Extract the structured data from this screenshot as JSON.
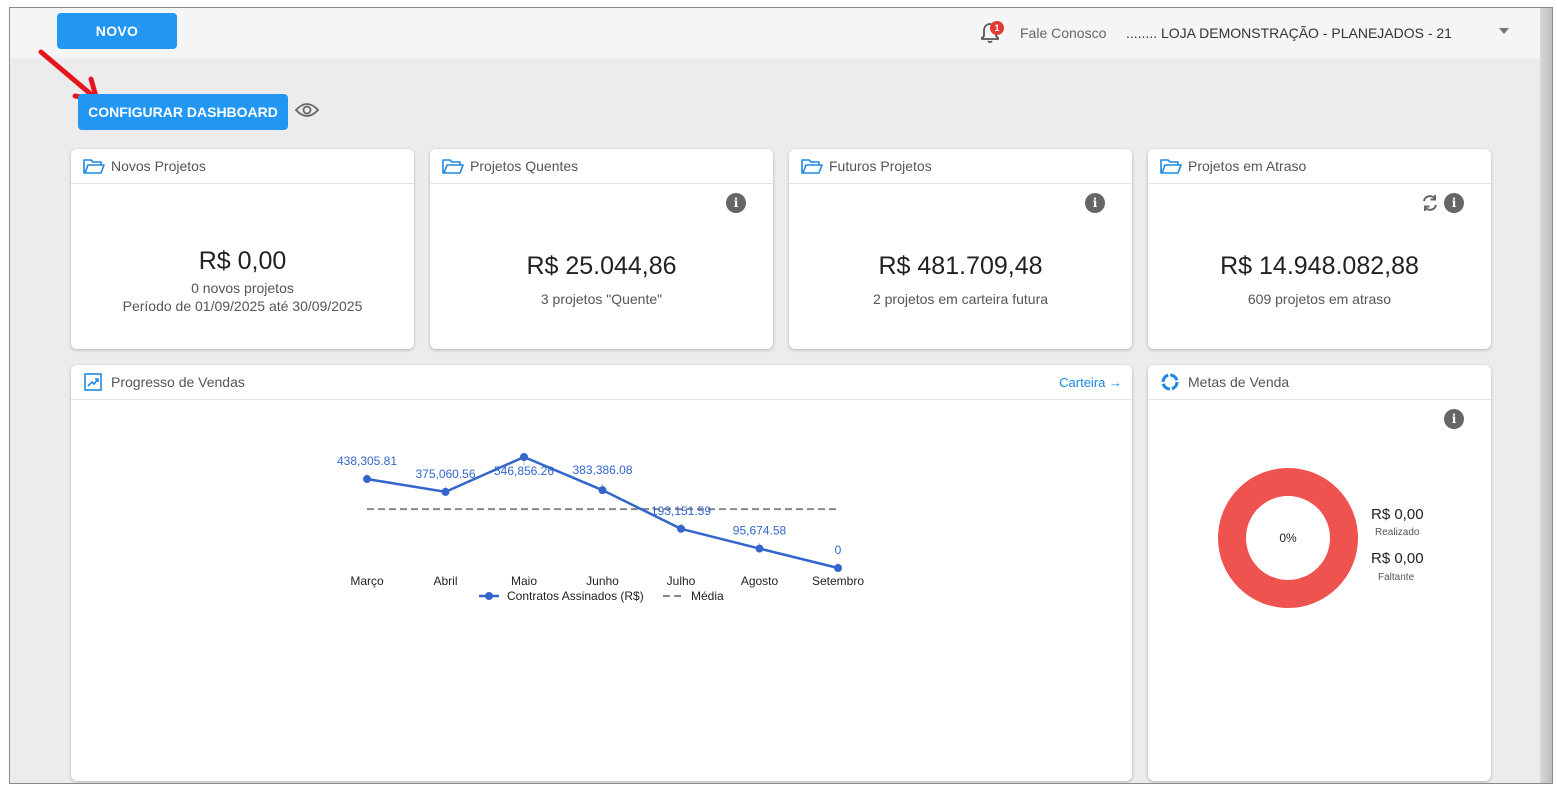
{
  "header": {
    "new_button": "NOVO",
    "notification_count": "1",
    "contact_link": "Fale Conosco",
    "store_selector": "........ LOJA DEMONSTRAÇÃO - PLANEJADOS - 21"
  },
  "toolbar": {
    "configure_button": "CONFIGURAR DASHBOARD"
  },
  "colors": {
    "accent": "#2196f3",
    "line": "#3366cc",
    "donut": "#ef5350"
  },
  "cards": [
    {
      "title": "Novos Projetos",
      "icon": "folder-icon",
      "value": "R$ 0,00",
      "line1": "0 novos projetos",
      "line2": "Período de 01/09/2025 até 30/09/2025"
    },
    {
      "title": "Projetos Quentes",
      "icon": "folder-icon",
      "value": "R$ 25.044,86",
      "line1": "3 projetos \"Quente\""
    },
    {
      "title": "Futuros Projetos",
      "icon": "folder-icon",
      "value": "R$ 481.709,48",
      "line1": "2 projetos em carteira futura"
    },
    {
      "title": "Projetos em Atraso",
      "icon": "folder-icon",
      "value": "R$ 14.948.082,88",
      "line1": "609 projetos em atraso"
    }
  ],
  "sales_progress": {
    "title": "Progresso de Vendas",
    "link": "Carteira →"
  },
  "chart_data": {
    "type": "line",
    "categories": [
      "Março",
      "Abril",
      "Maio",
      "Junho",
      "Julho",
      "Agosto",
      "Setembro"
    ],
    "series": [
      {
        "name": "Contratos Assinados (R$)",
        "values": [
          438305.81,
          375060.56,
          546856.26,
          383386.08,
          193151.59,
          95674.58,
          0
        ],
        "labels": [
          "438,305.81",
          "375,060.56",
          "546,856.26",
          "383,386.08",
          "193,151.59",
          "95,674.58",
          "0"
        ]
      },
      {
        "name": "Média",
        "values": [
          290347.83,
          290347.83,
          290347.83,
          290347.83,
          290347.83,
          290347.83,
          290347.83
        ],
        "style": "dashed"
      }
    ],
    "ylim": [
      0,
      600000
    ],
    "grid": false,
    "legend": "bottom"
  },
  "sales_goals": {
    "title": "Metas de Venda",
    "percent_label": "0%",
    "realized_value": "R$ 0,00",
    "realized_label": "Realizado",
    "remaining_value": "R$ 0,00",
    "remaining_label": "Faltante",
    "percent": 0
  }
}
